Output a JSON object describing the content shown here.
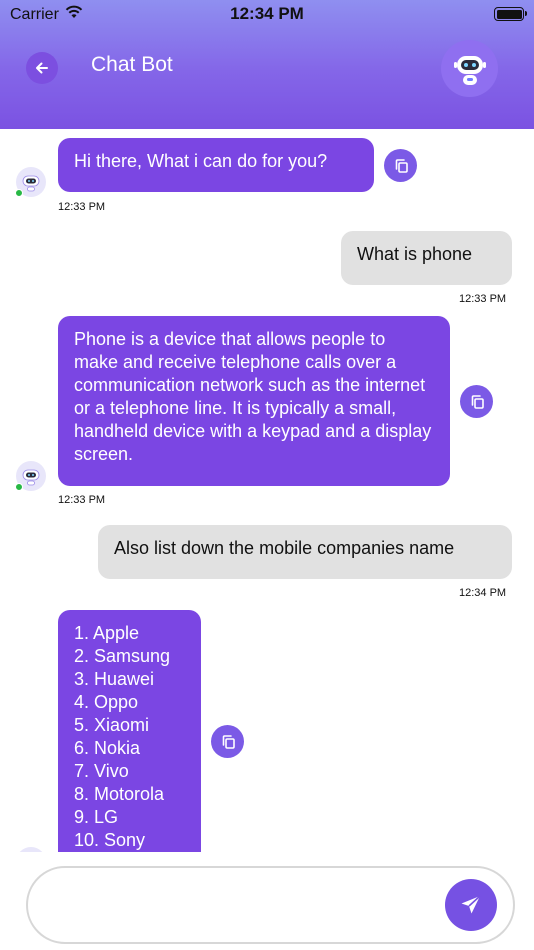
{
  "status_bar": {
    "carrier": "Carrier",
    "time": "12:34 PM"
  },
  "header": {
    "title": "Chat Bot",
    "back_icon": "arrow-left-icon",
    "avatar_icon": "robot-icon"
  },
  "messages": [
    {
      "sender": "bot",
      "text": "Hi there, What i can do for you?",
      "time": "12:33 PM"
    },
    {
      "sender": "user",
      "text": "What is phone",
      "time": "12:33 PM"
    },
    {
      "sender": "bot",
      "text": "Phone is a device that allows people to make and receive telephone calls over a communication network such as the internet or a telephone line. It is typically a small, handheld device with a keypad and a display screen.",
      "time": "12:33 PM"
    },
    {
      "sender": "user",
      "text": "Also list down the mobile companies name",
      "time": "12:34 PM"
    },
    {
      "sender": "bot",
      "items": [
        "1. Apple",
        "2. Samsung",
        "3. Huawei",
        "4. Oppo",
        "5. Xiaomi",
        "6. Nokia",
        "7. Vivo",
        "8. Motorola",
        "9. LG",
        "10. Sony"
      ]
    }
  ],
  "composer": {
    "placeholder": "",
    "send_icon": "send-icon"
  },
  "colors": {
    "accent": "#7b46e3",
    "header_top": "#8f8ff0",
    "user_bubble": "#e1e1e1",
    "online": "#27b844"
  }
}
